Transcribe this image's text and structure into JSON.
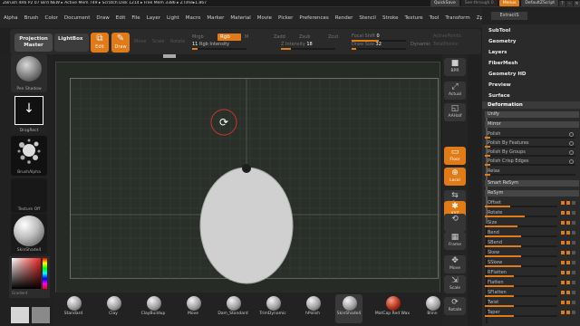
{
  "titlebar": {
    "info": "ZBrush 4R6 P2   07 Bird NEW   ▸ Active Mem 749 ▸ Scratch Disk 1214 ▸ Free Mem 3386 ▸ ZTime▸1.867",
    "quicksave": "QuickSave",
    "seethrough": "See-through  0",
    "menus": "Menus",
    "defaultscript": "DefaultZScript"
  },
  "menubar": [
    "Alpha",
    "Brush",
    "Color",
    "Document",
    "Draw",
    "Edit",
    "File",
    "Layer",
    "Light",
    "Macro",
    "Marker",
    "Material",
    "Movie",
    "Picker",
    "Preferences",
    "Render",
    "Stencil",
    "Stroke",
    "Texture",
    "Tool",
    "Transform",
    "Zplugin",
    "Zscript"
  ],
  "topshelf": {
    "projection_master": "Projection Master",
    "lightbox": "LightBox",
    "edit": "Edit",
    "draw": "Draw",
    "ghost_move": "Move",
    "ghost_scale": "Scale",
    "ghost_rotate": "Rotate",
    "mrgb": "Mrgb",
    "rgb": "Rgb",
    "m": "M",
    "zadd": "Zadd",
    "zsub": "Zsub",
    "zcut": "Zcut",
    "rgb_intensity_label": "Rgb Intensity",
    "rgb_intensity_value": "11",
    "z_intensity_label": "Z Intensity",
    "z_intensity_value": "18",
    "focal_shift_label": "Focal Shift",
    "focal_shift_value": "0",
    "draw_size_label": "Draw Size",
    "draw_size_value": "32",
    "dynamic": "Dynamic",
    "active_points": "ActivePoints:",
    "total_points": "TotalPoints:"
  },
  "lefttray": {
    "material_label": "Pen Shadow",
    "stroke_label": "DragRect",
    "alpha_label": "BrushAlpha",
    "texture_label": "Texture Off",
    "matcap_label": "SkinShade4",
    "gradient_label": "Gradient"
  },
  "rightshelf": [
    {
      "label": "BPR",
      "glyph": "■",
      "orange": false
    },
    {
      "label": "Actual",
      "glyph": "⤢",
      "orange": false
    },
    {
      "label": "AAHalf",
      "glyph": "◱",
      "orange": false
    },
    {
      "label": "Floor",
      "glyph": "▭",
      "orange": true
    },
    {
      "label": "Local",
      "glyph": "⊕",
      "orange": true
    },
    {
      "label": "L.Sym",
      "glyph": "⇆",
      "orange": false
    },
    {
      "label": "XYZ",
      "glyph": "✱",
      "orange": true
    },
    {
      "label": "",
      "glyph": "⟲",
      "orange": false
    },
    {
      "label": "Frame",
      "glyph": "▦",
      "orange": false
    },
    {
      "label": "Move",
      "glyph": "✥",
      "orange": false
    },
    {
      "label": "Scale",
      "glyph": "⇲",
      "orange": false
    },
    {
      "label": "Rotate",
      "glyph": "⟳",
      "orange": false
    }
  ],
  "brushes": [
    {
      "name": "Standard",
      "selected": false
    },
    {
      "name": "Clay",
      "selected": false
    },
    {
      "name": "ClayBuildup",
      "selected": false
    },
    {
      "name": "Move",
      "selected": false
    },
    {
      "name": "Dam_Standard",
      "selected": false
    },
    {
      "name": "TrimDynamic",
      "selected": false
    },
    {
      "name": "hPolish",
      "selected": false
    },
    {
      "name": "SkinShade4",
      "selected": true
    },
    {
      "name": "MatCap Red Wax",
      "selected": false
    },
    {
      "name": "Blinn",
      "selected": false
    }
  ],
  "rightpanel": {
    "top_button": "ExtractS",
    "menus": [
      "SubTool",
      "Geometry",
      "Layers",
      "FiberMesh",
      "Geometry HD",
      "Preview",
      "Surface"
    ],
    "deformation": "Deformation",
    "unify": "Unify",
    "mirror": "Mirror",
    "polish": "Polish",
    "polish_features": "Polish By Features",
    "polish_groups": "Polish By Groups",
    "polish_crisp": "Polish Crisp Edges",
    "relax": "Relax",
    "smart_resym": "Smart ReSym",
    "resym": "ReSym",
    "sliders": [
      {
        "label": "Offset",
        "fill": 0.35
      },
      {
        "label": "Rotate",
        "fill": 0.55
      },
      {
        "label": "Size",
        "fill": 0.45
      },
      {
        "label": "Bend",
        "fill": 0.5
      },
      {
        "label": "SBend",
        "fill": 0.5
      },
      {
        "label": "Skew",
        "fill": 0.5
      },
      {
        "label": "SSkew",
        "fill": 0.5
      },
      {
        "label": "RFlatten",
        "fill": 0.4
      },
      {
        "label": "Flatten",
        "fill": 0.4
      },
      {
        "label": "SFlatten",
        "fill": 0.4
      },
      {
        "label": "Twist",
        "fill": 0.4
      },
      {
        "label": "Taper",
        "fill": 0.4
      }
    ]
  }
}
